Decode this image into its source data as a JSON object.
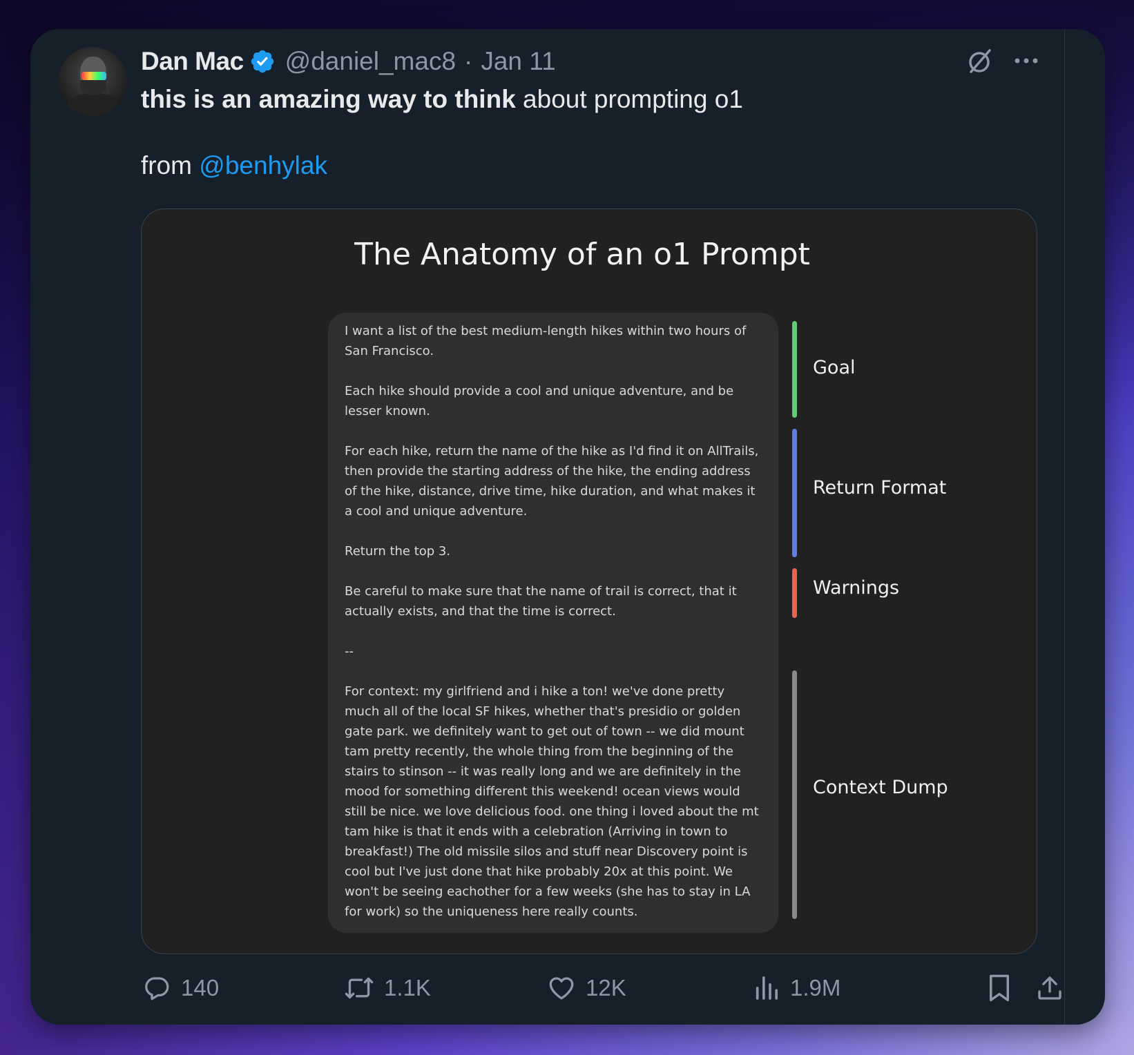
{
  "tweet": {
    "author_name": "Dan Mac",
    "handle": "@daniel_mac8",
    "separator": "·",
    "date": "Jan 11",
    "text_bold": "this is an amazing way to think",
    "text_rest": " about prompting o1",
    "from_prefix": "from ",
    "mention": "@benhylak"
  },
  "media": {
    "title": "The Anatomy of an o1 Prompt",
    "paragraphs": [
      "I want a list of the best medium-length hikes within two hours of San Francisco.",
      "Each hike should provide a cool and unique adventure, and be lesser known.",
      "For each hike, return the name of the hike as I'd find it on AllTrails, then provide the starting address of the hike, the ending address of the hike, distance, drive time, hike duration, and what makes it a cool and unique adventure.",
      "Return the top 3.",
      "Be careful to make sure that the name of trail is correct, that it actually exists, and that the time is correct.",
      "--",
      "For context: my girlfriend and i hike a ton! we've done pretty much all of the local SF hikes, whether that's presidio or golden gate park. we definitely want to get out of town -- we did mount tam pretty recently, the whole thing from the beginning of the stairs to stinson -- it was really long and we are definitely in the mood for something different this weekend! ocean views would still be nice. we love delicious food. one thing i loved about the mt tam hike is that it ends with a celebration (Arriving in town to breakfast!) The old missile silos and stuff near Discovery point is cool but I've just done that hike probably 20x at this point. We won't be seeing eachother for a few weeks (she has to stay in LA for work) so the uniqueness here really counts."
    ],
    "segments": {
      "goal": {
        "label": "Goal",
        "color": "#5fce73"
      },
      "return_format": {
        "label": "Return Format",
        "color": "#5f7fe6"
      },
      "warnings": {
        "label": "Warnings",
        "color": "#e8654d"
      },
      "context_dump": {
        "label": "Context Dump",
        "color": "#8a8a8a"
      }
    }
  },
  "actions": {
    "replies": "140",
    "retweets": "1.1K",
    "likes": "12K",
    "views": "1.9M"
  },
  "icons": [
    "verified-badge-icon",
    "grok-icon",
    "more-icon",
    "reply-icon",
    "retweet-icon",
    "like-icon",
    "views-icon",
    "bookmark-icon",
    "share-icon"
  ],
  "colors": {
    "accent": "#1d9bf0",
    "card_bg": "#15202b",
    "text": "#e7e9ea",
    "muted": "#8b98a5"
  }
}
